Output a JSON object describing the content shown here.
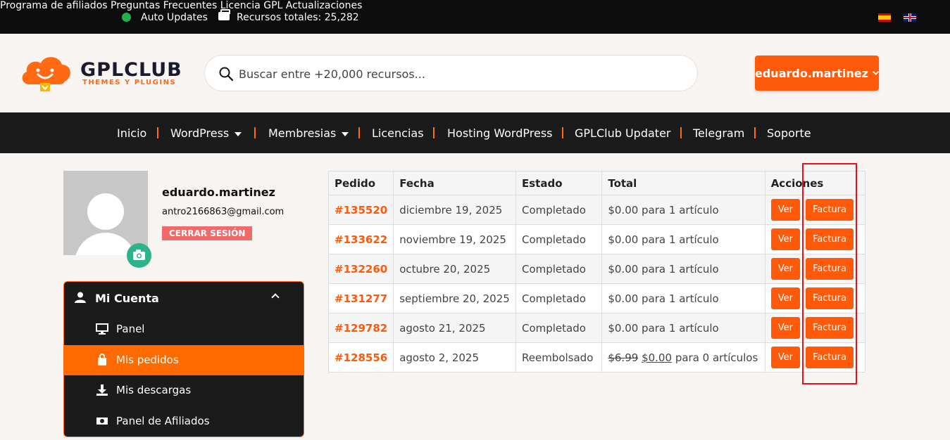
{
  "topbar": {
    "auto_updates": "Auto Updates",
    "resources": "Recursos totales: 25,282",
    "links": [
      "Programa de afiliados",
      "Preguntas Frecuentes",
      "Licencia GPL",
      "Actualizaciones"
    ]
  },
  "header": {
    "logo_text": "GPLCLUB",
    "logo_sub": "THEMES Y PLUGINS",
    "search_placeholder": "Buscar entre +20,000 recursos...",
    "user_button": "eduardo.martinez"
  },
  "nav": [
    "Inicio",
    "WordPress",
    "Membresias",
    "Licencias",
    "Hosting WordPress",
    "GPLClub Updater",
    "Telegram",
    "Soporte"
  ],
  "profile": {
    "username": "eduardo.martinez",
    "email": "antro2166863@gmail.com",
    "logout": "CERRAR SESIÓN"
  },
  "sidebar": {
    "header": "Mi Cuenta",
    "items": [
      "Panel",
      "Mis pedidos",
      "Mis descargas",
      "Panel de Afiliados"
    ]
  },
  "table": {
    "headers": [
      "Pedido",
      "Fecha",
      "Estado",
      "Total",
      "Acciones"
    ],
    "rows": [
      {
        "order": "#135520",
        "date": "diciembre 19, 2025",
        "status": "Completado",
        "total": "$0.00 para 1 artículo"
      },
      {
        "order": "#133622",
        "date": "noviembre 19, 2025",
        "status": "Completado",
        "total": "$0.00 para 1 artículo"
      },
      {
        "order": "#132260",
        "date": "octubre 20, 2025",
        "status": "Completado",
        "total": "$0.00 para 1 artículo"
      },
      {
        "order": "#131277",
        "date": "septiembre 20, 2025",
        "status": "Completado",
        "total": "$0.00 para 1 artículo"
      },
      {
        "order": "#129782",
        "date": "agosto 21, 2025",
        "status": "Completado",
        "total": "$0.00 para 1 artículo"
      },
      {
        "order": "#128556",
        "date": "agosto 2, 2025",
        "status": "Reembolsado",
        "total_old": "$6.99",
        "total_new": "$0.00",
        "total_rest": "para 0 artículos"
      }
    ],
    "btn_view": "Ver",
    "btn_invoice": "Factura"
  }
}
